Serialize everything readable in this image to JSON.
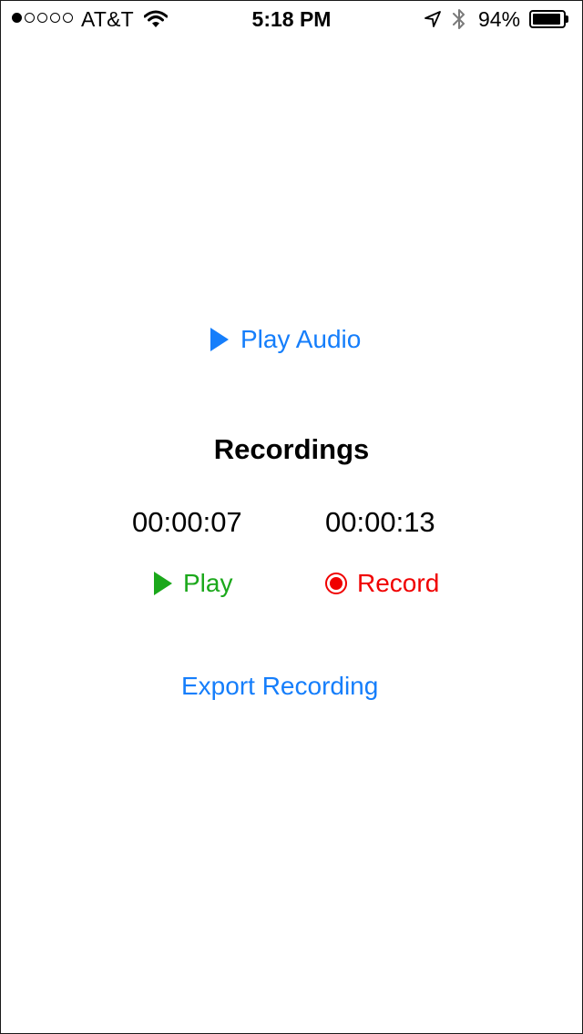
{
  "status_bar": {
    "signal_filled": 1,
    "signal_total": 5,
    "carrier": "AT&T",
    "time": "5:18 PM",
    "battery_percent": "94%",
    "battery_level": 0.94,
    "icons": [
      "wifi-icon",
      "location-arrow-icon",
      "bluetooth-icon",
      "battery-icon"
    ]
  },
  "main": {
    "play_audio_label": "Play Audio",
    "recordings_title": "Recordings",
    "time_left": "00:00:07",
    "time_right": "00:00:13",
    "play_label": "Play",
    "record_label": "Record",
    "export_label": "Export Recording"
  },
  "colors": {
    "blue": "#157EFB",
    "green": "#1BA81B",
    "red": "#F00000"
  }
}
